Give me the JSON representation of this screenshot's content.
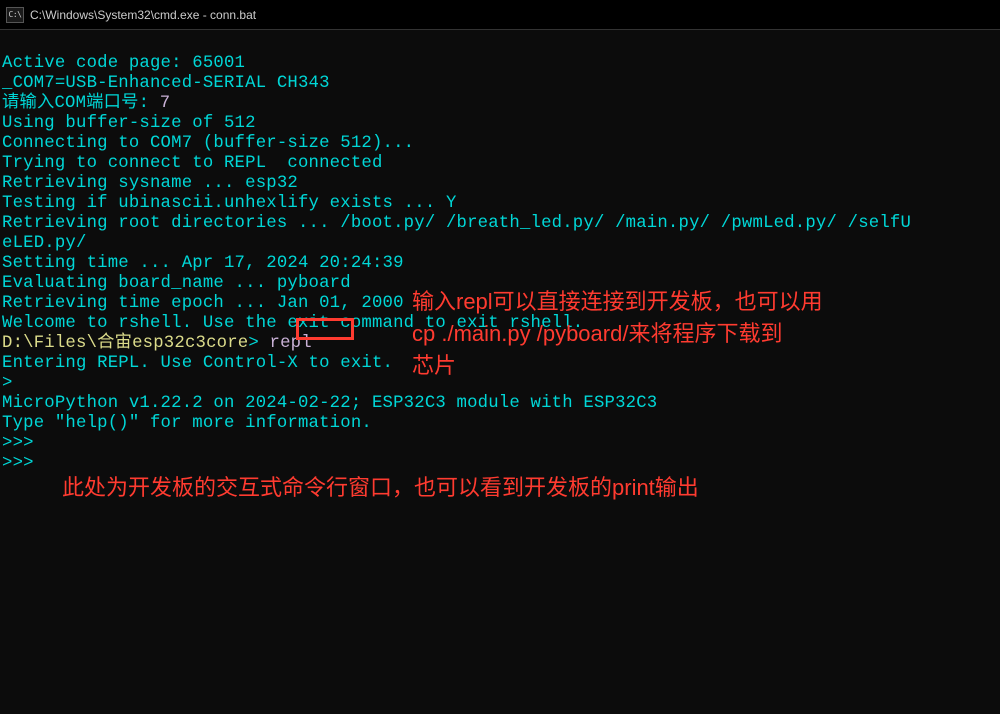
{
  "window": {
    "title": "C:\\Windows\\System32\\cmd.exe - conn.bat",
    "icon_label": "C:\\"
  },
  "lines": {
    "l1": "Active code page: 65001",
    "l2": "_COM7=USB-Enhanced-SERIAL CH343",
    "l3a": "请输入COM端口号: ",
    "l3b": "7",
    "l4": "Using buffer-size of 512",
    "l5": "Connecting to COM7 (buffer-size 512)...",
    "l6": "Trying to connect to REPL  connected",
    "l7": "Retrieving sysname ... esp32",
    "l8": "Testing if ubinascii.unhexlify exists ... Y",
    "l9": "Retrieving root directories ... /boot.py/ /breath_led.py/ /main.py/ /pwmLed.py/ /selfU",
    "l10": "eLED.py/",
    "l11": "Setting time ... Apr 17, 2024 20:24:39",
    "l12": "Evaluating board_name ... pyboard",
    "l13": "Retrieving time epoch ... Jan 01, 2000",
    "l14": "Welcome to rshell. Use the exit command to exit rshell.",
    "l15path": "D:\\Files\\合宙esp32c3core",
    "l15gt": "> ",
    "l15cmd": "repl",
    "l16": "Entering REPL. Use Control-X to exit.",
    "l17": ">",
    "l18": "MicroPython v1.22.2 on 2024-02-22; ESP32C3 module with ESP32C3",
    "l19": "Type \"help()\" for more information.",
    "l20": ">>>",
    "l21": ">>>"
  },
  "annotations": {
    "a1_line1": "输入repl可以直接连接到开发板，也可以用",
    "a1_line2": "cp ./main.py /pyboard/来将程序下载到",
    "a1_line3": "芯片",
    "a2": "此处为开发板的交互式命令行窗口，也可以看到开发板的print输出"
  }
}
